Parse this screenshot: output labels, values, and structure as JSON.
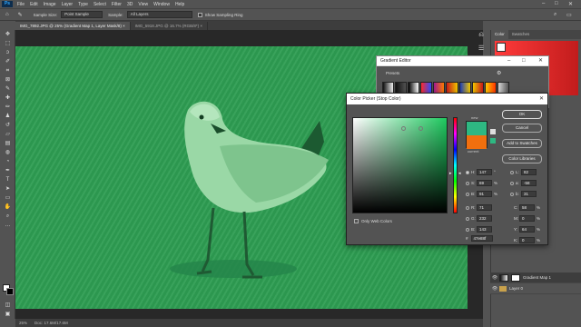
{
  "menu": {
    "logo": "Ps",
    "items": [
      "File",
      "Edit",
      "Image",
      "Layer",
      "Type",
      "Select",
      "Filter",
      "3D",
      "View",
      "Window",
      "Help"
    ]
  },
  "options": {
    "sample_size_label": "Sample Size:",
    "sample_size_value": "Point Sample",
    "sample_label": "Sample:",
    "sample_value": "All Layers",
    "show_ring_label": "Show Sampling Ring"
  },
  "tabs": [
    {
      "label": "IMG_7892.JPG @ 25% (Gradient Map 1, Layer Mask/8)",
      "active": true
    },
    {
      "label": "IMG_5918.JPG @ 16.7% (RGB/8*)",
      "active": false
    }
  ],
  "status": {
    "zoom": "25%",
    "doc": "Doc: 17.6M/17.6M"
  },
  "panel": {
    "tab_color": "Color",
    "tab_swatches": "Swatches"
  },
  "layers": [
    {
      "name": "Gradient Map 1",
      "type": "adjustment",
      "selected": true
    },
    {
      "name": "Layer 0",
      "type": "image",
      "selected": false
    }
  ],
  "gradient_editor": {
    "title": "Gradient Editor",
    "presets_label": "Presets",
    "preset_colors": [
      "#111111",
      "#e6e6e6",
      "#5a5a5a",
      "#ff2b2b",
      "#9e1b8f",
      "#ff7a00",
      "#c81818",
      "#1f3fb8",
      "#f2c800",
      "#d8d8d8"
    ]
  },
  "color_picker": {
    "title": "Color Picker (Stop Color)",
    "new_label": "new",
    "current_label": "current",
    "new_color": "#2eb882",
    "current_color": "#f26f0e",
    "buttons": {
      "ok": "OK",
      "cancel": "Cancel",
      "add": "Add to Swatches",
      "libraries": "Color Libraries"
    },
    "web_only": "Only Web Colors",
    "hsb": {
      "H": "147",
      "S": "69",
      "B": "91"
    },
    "rgb": {
      "R": "71",
      "G": "232",
      "B": "143"
    },
    "lab": {
      "L": "82",
      "a": "-58",
      "b": "31"
    },
    "cmyk": {
      "C": "58",
      "M": "0",
      "Y": "64",
      "K": "0"
    },
    "units": {
      "H": "°",
      "S": "%",
      "B": "%",
      "C": "%",
      "M": "%",
      "Y": "%",
      "K": "%"
    },
    "hex": "47e88f"
  },
  "ui_colors": {
    "workspace": "#535353",
    "photo_tint": "#2e9d52"
  }
}
